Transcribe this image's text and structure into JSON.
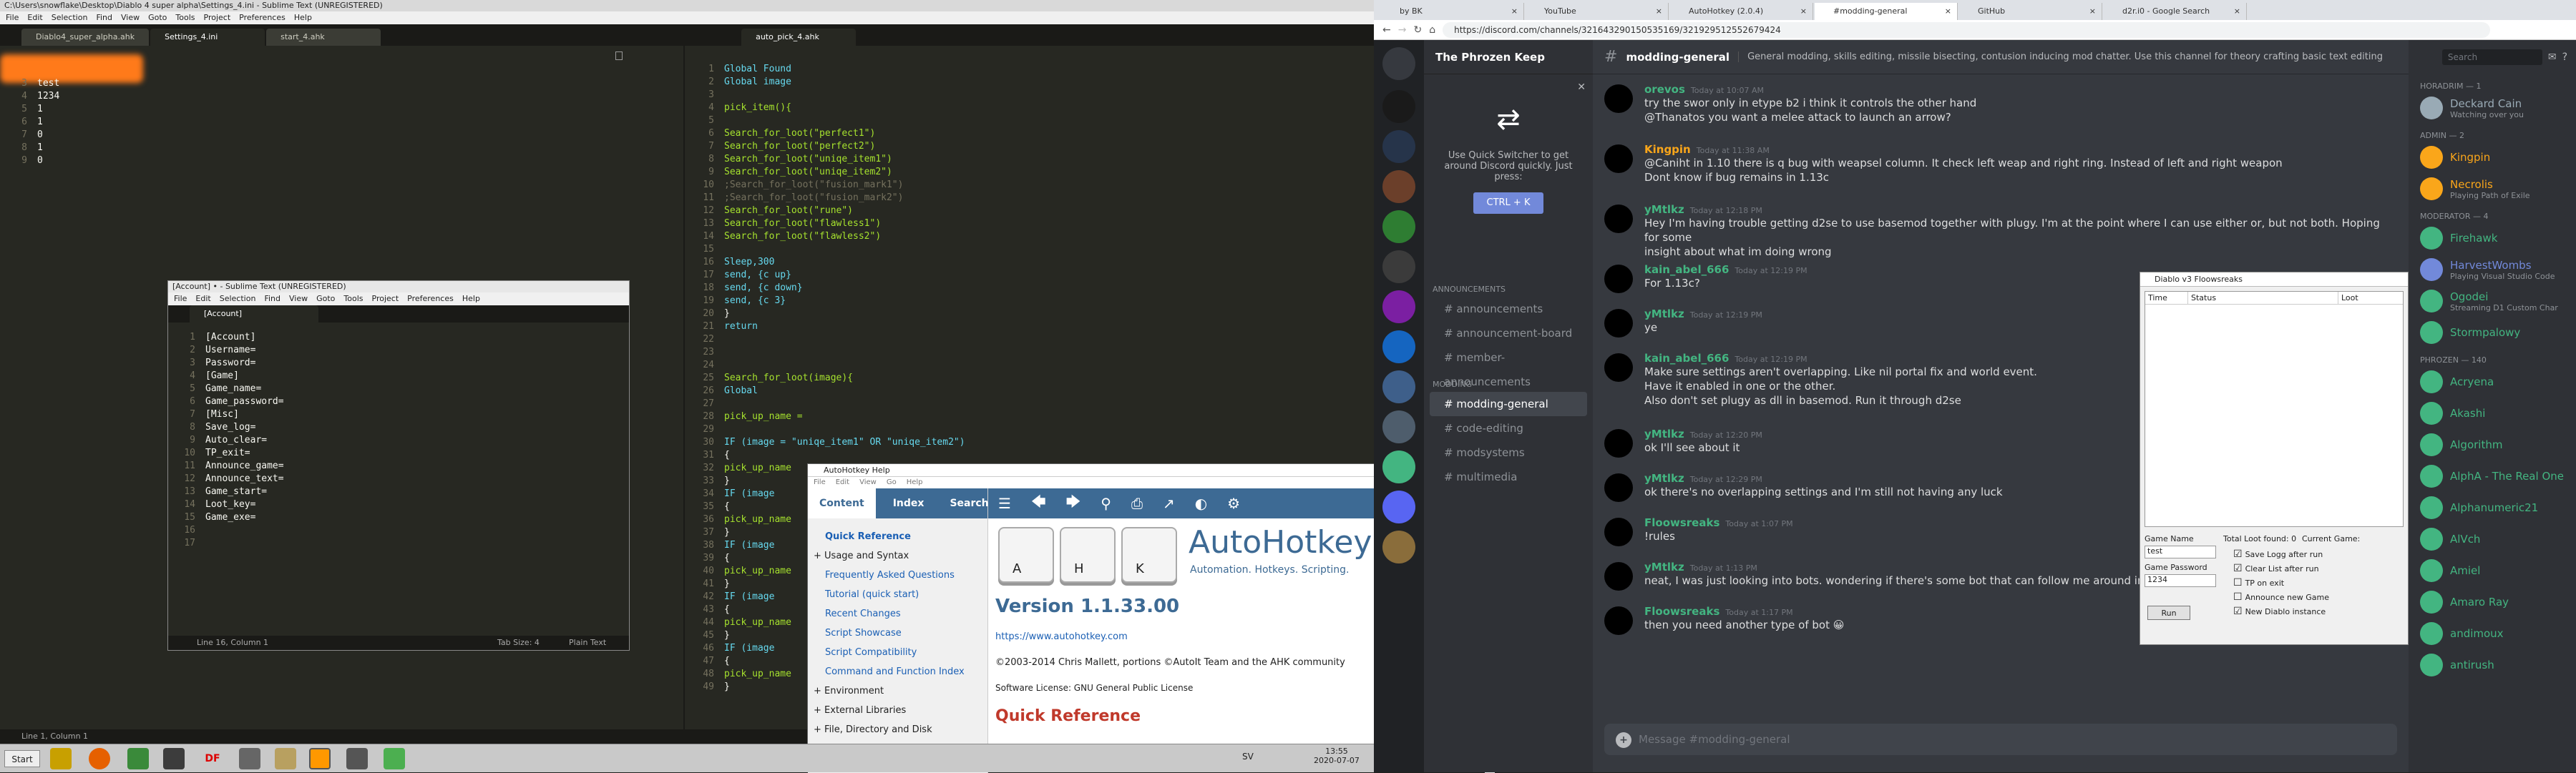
{
  "sublime": {
    "title": "C:\\Users\\snowflake\\Desktop\\Diablo 4 super alpha\\Settings_4.ini - Sublime Text (UNREGISTERED)",
    "menu": [
      "File",
      "Edit",
      "Selection",
      "Find",
      "View",
      "Goto",
      "Tools",
      "Project",
      "Preferences",
      "Help"
    ],
    "tabs": [
      "Diablo4_super_alpha.ahk",
      "Settings_4.ini",
      "start_4.ahk"
    ],
    "right_tab": "auto_pick_4.ahk",
    "status": "Line 1, Column 1",
    "left_lines": [
      {
        "n": "3",
        "t": "test"
      },
      {
        "n": "4",
        "t": "1234"
      },
      {
        "n": "5",
        "t": "1"
      },
      {
        "n": "6",
        "t": "1"
      },
      {
        "n": "7",
        "t": "0"
      },
      {
        "n": "8",
        "t": "1"
      },
      {
        "n": "9",
        "t": "0"
      }
    ],
    "right_lines": [
      {
        "n": "1",
        "t": "Global Found"
      },
      {
        "n": "2",
        "t": "Global image"
      },
      {
        "n": "3",
        "t": ""
      },
      {
        "n": "4",
        "t": "pick_item(){"
      },
      {
        "n": "5",
        "t": ""
      },
      {
        "n": "6",
        "t": "Search_for_loot(\"perfect1\")"
      },
      {
        "n": "7",
        "t": "Search_for_loot(\"perfect2\")"
      },
      {
        "n": "8",
        "t": "Search_for_loot(\"uniqe_item1\")"
      },
      {
        "n": "9",
        "t": "Search_for_loot(\"uniqe_item2\")"
      },
      {
        "n": "10",
        "t": ";Search_for_loot(\"fusion_mark1\")"
      },
      {
        "n": "11",
        "t": ";Search_for_loot(\"fusion_mark2\")"
      },
      {
        "n": "12",
        "t": "Search_for_loot(\"rune\")"
      },
      {
        "n": "13",
        "t": "Search_for_loot(\"flawless1\")"
      },
      {
        "n": "14",
        "t": "Search_for_loot(\"flawless2\")"
      },
      {
        "n": "15",
        "t": ""
      },
      {
        "n": "16",
        "t": "Sleep,300"
      },
      {
        "n": "17",
        "t": "send, {c up}"
      },
      {
        "n": "18",
        "t": "send, {c down}"
      },
      {
        "n": "19",
        "t": "send, {c 3}"
      },
      {
        "n": "20",
        "t": "}"
      },
      {
        "n": "21",
        "t": "return"
      },
      {
        "n": "22",
        "t": ""
      },
      {
        "n": "23",
        "t": ""
      },
      {
        "n": "24",
        "t": ""
      },
      {
        "n": "25",
        "t": "Search_for_loot(image){"
      },
      {
        "n": "26",
        "t": "Global"
      },
      {
        "n": "27",
        "t": ""
      },
      {
        "n": "28",
        "t": "pick_up_name ="
      },
      {
        "n": "29",
        "t": ""
      },
      {
        "n": "30",
        "t": "IF (image = \"uniqe_item1\" OR \"uniqe_item2\")"
      },
      {
        "n": "31",
        "t": "{"
      },
      {
        "n": "32",
        "t": "pick_up_name"
      },
      {
        "n": "33",
        "t": "}"
      },
      {
        "n": "34",
        "t": "IF (image"
      },
      {
        "n": "35",
        "t": "{"
      },
      {
        "n": "36",
        "t": "pick_up_name"
      },
      {
        "n": "37",
        "t": "}"
      },
      {
        "n": "38",
        "t": "IF (image"
      },
      {
        "n": "39",
        "t": "{"
      },
      {
        "n": "40",
        "t": "pick_up_name"
      },
      {
        "n": "41",
        "t": "}"
      },
      {
        "n": "42",
        "t": "IF (image"
      },
      {
        "n": "43",
        "t": "{"
      },
      {
        "n": "44",
        "t": "pick_up_name"
      },
      {
        "n": "45",
        "t": "}"
      },
      {
        "n": "46",
        "t": "IF (image"
      },
      {
        "n": "47",
        "t": "{"
      },
      {
        "n": "48",
        "t": "pick_up_name"
      },
      {
        "n": "49",
        "t": "}"
      }
    ]
  },
  "sub2": {
    "title": "[Account] • - Sublime Text (UNREGISTERED)",
    "menu": [
      "File",
      "Edit",
      "Selection",
      "Find",
      "View",
      "Goto",
      "Tools",
      "Project",
      "Preferences",
      "Help"
    ],
    "tab": "[Account]",
    "lines": [
      "[Account]",
      "Username=",
      "Password=",
      "[Game]",
      "Game_name=",
      "Game_password=",
      "[Misc]",
      "Save_log=",
      "Auto_clear=",
      "TP_exit=",
      "Announce_game=",
      "Announce_text=",
      "Game_start=",
      "Loot_key=",
      "Game_exe=",
      "",
      ""
    ],
    "status_left": "Line 16, Column 1",
    "status_tab": "Tab Size: 4",
    "status_syntax": "Plain Text"
  },
  "taskbar": {
    "start": "Start",
    "lang": "SV",
    "time": "13:55",
    "date": "2020-07-07"
  },
  "browser": {
    "tabs": [
      "by BK",
      "YouTube",
      "AutoHotkey (2.0.4)",
      "#modding-general",
      "GitHub",
      "d2r.i0 - Google Search"
    ],
    "url": "https://discord.com/channels/321643290150535169/321929512552679424"
  },
  "discord": {
    "server": "The Phrozen Keep",
    "quick_switcher_text": "Use Quick Switcher to get around Discord quickly. Just press:",
    "quick_switcher_key": "CTRL + K",
    "categories": [
      "ANNOUNCEMENTS",
      "MODDING"
    ],
    "channels_ann": [
      "announcements",
      "announcement-board",
      "member-announcements"
    ],
    "channels_mod": [
      "modding-general",
      "code-editing",
      "modsystems",
      "multimedia"
    ],
    "channel_title": "modding-general",
    "channel_topic": "General modding, skills editing, missile bisecting, contusion inducing mod chatter. Use this channel for theory crafting basic text editing.",
    "search_placeholder": "Search",
    "input_placeholder": "Message #modding-general",
    "messages": [
      {
        "name": "orevos",
        "time": "Today at 10:07 AM",
        "color": "#43b581",
        "lines": [
          "try the swor only in etype b2 i think it controls the other hand",
          "@Thanatos you want a melee attack to launch an arrow?"
        ]
      },
      {
        "name": "Kingpin",
        "time": "Today at 11:38 AM",
        "color": "#faa61a",
        "lines": [
          "@Caniht in 1.10 there is q bug with weapsel column. It check left weap and right ring. Instead of left and right weapon",
          "Dont know if bug remains in 1.13c"
        ]
      },
      {
        "name": "yMtlkz",
        "time": "Today at 12:18 PM",
        "color": "#43b581",
        "lines": [
          "Hey I'm having trouble getting d2se to use basemod together with plugy. I'm at the point where I can use either or, but not both. Hoping for some",
          "insight about what im doing wrong"
        ]
      },
      {
        "name": "kain_abel_666",
        "time": "Today at 12:19 PM",
        "color": "#43b581",
        "lines": [
          "For 1.13c?"
        ]
      },
      {
        "name": "yMtlkz",
        "time": "Today at 12:19 PM",
        "color": "#43b581",
        "lines": [
          "ye"
        ]
      },
      {
        "name": "kain_abel_666",
        "time": "Today at 12:19 PM",
        "color": "#43b581",
        "lines": [
          "Make sure settings aren't overlapping. Like nil portal fix and world event.",
          "Have it enabled in one or the other.",
          "Also don't set plugy as dll in basemod. Run it through d2se"
        ]
      },
      {
        "name": "yMtlkz",
        "time": "Today at 12:20 PM",
        "color": "#43b581",
        "lines": [
          "ok I'll see about it"
        ]
      },
      {
        "name": "yMtlkz",
        "time": "Today at 12:29 PM",
        "color": "#43b581",
        "lines": [
          "ok there's no overlapping settings and I'm still not having any luck"
        ]
      },
      {
        "name": "Floowsreaks",
        "time": "Today at 1:07 PM",
        "color": "#43b581",
        "lines": [
          "!rules"
        ]
      },
      {
        "name": "yMtlkz",
        "time": "Today at 1:13 PM",
        "color": "#43b581",
        "lines": [
          "neat, I was just looking into bots. wondering if there's some bot that can follow me around in single play"
        ]
      },
      {
        "name": "Floowsreaks",
        "time": "Today at 1:17 PM",
        "color": "#43b581",
        "lines": [
          "then you need another type of bot 😀"
        ]
      }
    ],
    "members": [
      {
        "cat": "HORADRIM — 1",
        "name": "Deckard Cain",
        "sub": "Watching over you",
        "color": "#99aab5"
      },
      {
        "cat": "ADMIN — 2",
        "name": "Kingpin",
        "sub": "",
        "color": "#faa61a"
      },
      {
        "cat": "",
        "name": "Necrolis",
        "sub": "Playing Path of Exile",
        "color": "#faa61a"
      },
      {
        "cat": "MODERATOR — 4",
        "name": "Firehawk",
        "sub": "",
        "color": "#43b581"
      },
      {
        "cat": "",
        "name": "HarvestWombs",
        "sub": "Playing Visual Studio Code",
        "color": "#7289da"
      },
      {
        "cat": "",
        "name": "Ogodei",
        "sub": "Streaming D1 Custom Char",
        "color": "#43b581"
      },
      {
        "cat": "",
        "name": "Stormpalowy",
        "sub": "",
        "color": "#43b581"
      },
      {
        "cat": "PHROZEN — 140",
        "name": "Acryena",
        "sub": "",
        "color": "#43b581"
      },
      {
        "cat": "",
        "name": "Akashi",
        "sub": "",
        "color": "#43b581"
      },
      {
        "cat": "",
        "name": "Algorithm",
        "sub": "",
        "color": "#43b581"
      },
      {
        "cat": "",
        "name": "AlphA - The Real One",
        "sub": "",
        "color": "#43b581"
      },
      {
        "cat": "",
        "name": "Alphanumeric21",
        "sub": "",
        "color": "#43b581"
      },
      {
        "cat": "",
        "name": "AlVch",
        "sub": "",
        "color": "#43b581"
      },
      {
        "cat": "",
        "name": "Amiel",
        "sub": "",
        "color": "#43b581"
      },
      {
        "cat": "",
        "name": "Amaro Ray",
        "sub": "",
        "color": "#43b581"
      },
      {
        "cat": "",
        "name": "andimoux",
        "sub": "",
        "color": "#43b581"
      },
      {
        "cat": "",
        "name": "antirush",
        "sub": "",
        "color": "#43b581"
      }
    ]
  },
  "ahk": {
    "title": "AutoHotkey Help",
    "menu": [
      "File",
      "Edit",
      "View",
      "Go",
      "Help"
    ],
    "tabs": [
      "Content",
      "Index",
      "Search"
    ],
    "toc": [
      {
        "label": "Quick Reference",
        "sign": ""
      },
      {
        "label": "Usage and Syntax",
        "sign": "+"
      },
      {
        "label": "Frequently Asked Questions",
        "sign": ""
      },
      {
        "label": "Tutorial (quick start)",
        "sign": ""
      },
      {
        "label": "Recent Changes",
        "sign": ""
      },
      {
        "label": "Script Showcase",
        "sign": ""
      },
      {
        "label": "Script Compatibility",
        "sign": ""
      },
      {
        "label": "Command and Function Index",
        "sign": ""
      },
      {
        "label": "Environment",
        "sign": "+"
      },
      {
        "label": "External Libraries",
        "sign": "+"
      },
      {
        "label": "File, Directory and Disk",
        "sign": "+"
      }
    ],
    "keys": [
      "A",
      "H",
      "K"
    ],
    "brand": "AutoHotkey",
    "tagline": "Automation. Hotkeys. Scripting.",
    "version": "Version 1.1.33.00",
    "site": "https://www.autohotkey.com",
    "copyright": "©2003-2014 Chris Mallett, portions ©AutoIt Team and the AHK community",
    "license": "Software License: GNU General Public License",
    "quickref": "Quick Reference"
  },
  "diablo": {
    "title": "Diablo v3 Floowsreaks",
    "cols": [
      "Time",
      "Status",
      "Loot"
    ],
    "game_name_label": "Game Name",
    "game_name": "test",
    "game_pass_label": "Game Password",
    "game_pass": "1234",
    "total_loot": "Total Loot found: 0",
    "current_game": "Current Game:",
    "checks": [
      {
        "label": "Save Logg after run",
        "checked": true
      },
      {
        "label": "Clear List after run",
        "checked": true
      },
      {
        "label": "TP on exit",
        "checked": false
      },
      {
        "label": "Announce new Game",
        "checked": false
      },
      {
        "label": "New Diablo instance",
        "checked": true
      }
    ],
    "run": "Run"
  }
}
